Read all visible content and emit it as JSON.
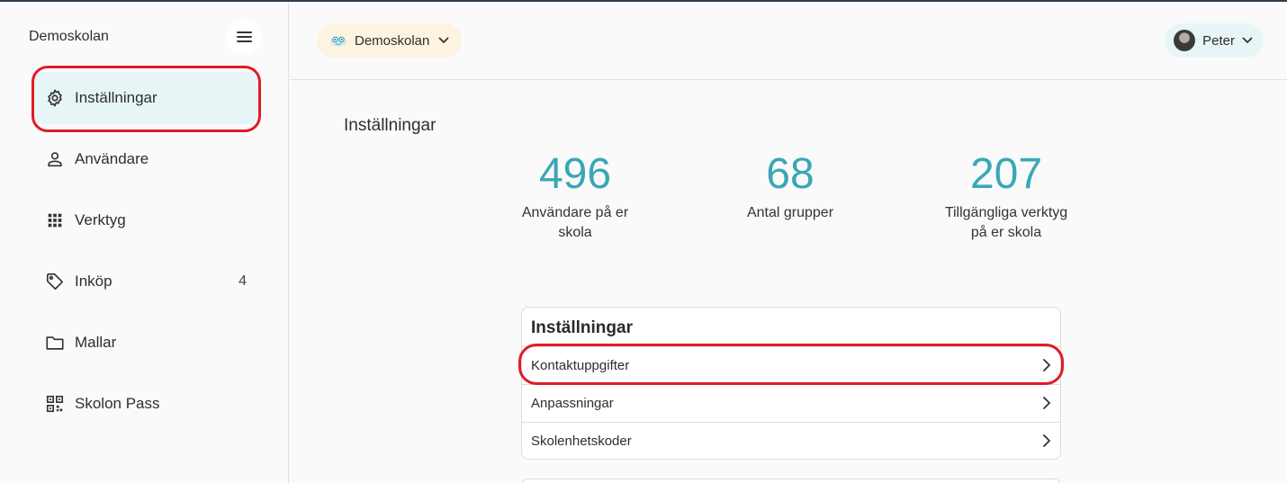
{
  "sidebar": {
    "title": "Demoskolan",
    "items": [
      {
        "label": "Inställningar",
        "icon": "gear-icon",
        "active": true
      },
      {
        "label": "Användare",
        "icon": "person-icon"
      },
      {
        "label": "Verktyg",
        "icon": "grid-icon"
      },
      {
        "label": "Inköp",
        "icon": "tag-icon",
        "count": "4"
      },
      {
        "label": "Mallar",
        "icon": "folder-icon"
      },
      {
        "label": "Skolon Pass",
        "icon": "qr-code-icon"
      }
    ]
  },
  "header": {
    "school": "Demoskolan",
    "user": "Peter"
  },
  "main": {
    "title": "Inställningar",
    "stats": [
      {
        "value": "496",
        "caption_line1": "Användare på er",
        "caption_line2": "skola"
      },
      {
        "value": "68",
        "caption_line1": "Antal grupper",
        "caption_line2": ""
      },
      {
        "value": "207",
        "caption_line1": "Tillgängliga verktyg",
        "caption_line2": "på er skola"
      }
    ],
    "settings_card": {
      "title": "Inställningar",
      "rows": [
        "Kontaktuppgifter",
        "Anpassningar",
        "Skolenhetskoder"
      ]
    }
  },
  "colors": {
    "accent": "#3aa7b5",
    "annotation": "#e01b24",
    "active_bg": "#e8f5f7",
    "school_pill_bg": "#fdf3e0"
  }
}
